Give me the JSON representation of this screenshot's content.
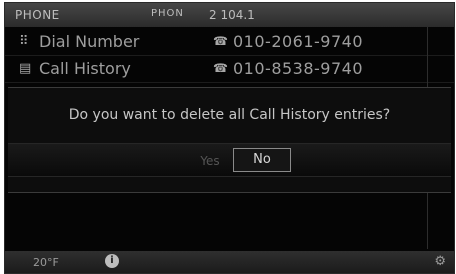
{
  "statusbar": {
    "title": "PHONE",
    "signal": "PHON",
    "frequency": "2 104.1"
  },
  "list": [
    {
      "icon": "dial-pad-icon",
      "label": "Dial Number",
      "phone_icon": "handset-icon",
      "number": "010-2061-9740"
    },
    {
      "icon": "call-history-icon",
      "label": "Call History",
      "phone_icon": "handset-icon",
      "number": "010-8538-9740"
    }
  ],
  "dialog": {
    "message": "Do you want to delete all Call History entries?",
    "yes_label": "Yes",
    "no_label": "No"
  },
  "bottombar": {
    "temperature": "20°F",
    "info_icon": "info-icon",
    "settings_icon": "gear-icon"
  }
}
